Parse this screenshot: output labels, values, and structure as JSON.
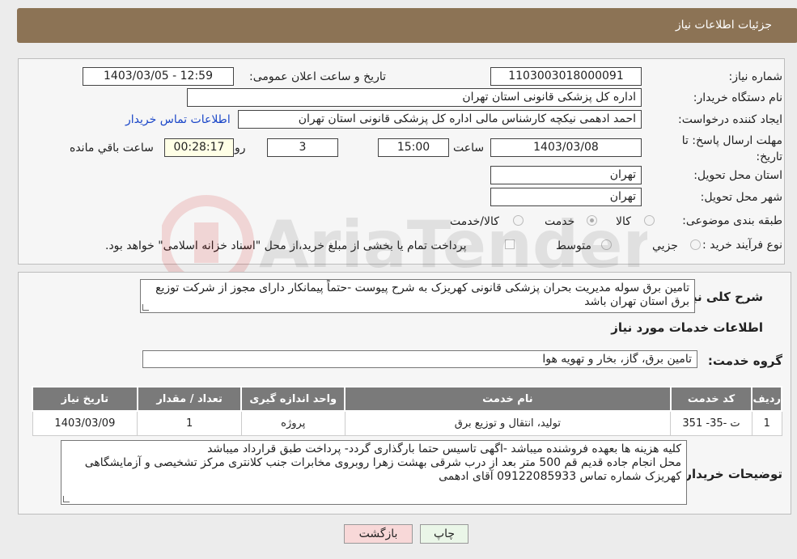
{
  "header": {
    "title": "جزئیات اطلاعات نیاز"
  },
  "form": {
    "need_number": {
      "label": "شماره نیاز:",
      "value": "1103003018000091"
    },
    "announce_datetime": {
      "label": "تاریخ و ساعت اعلان عمومی:",
      "value": "1403/03/05 - 12:59"
    },
    "buyer_org": {
      "label": "نام دستگاه خریدار:",
      "value": "اداره کل پزشکی قانونی استان تهران"
    },
    "requester": {
      "label": "ایجاد کننده درخواست:",
      "value": "احمد ادهمی نیکچه کارشناس مالی اداره کل پزشکی قانونی استان تهران",
      "contact_link": "اطلاعات تماس خریدار"
    },
    "deadline": {
      "label": "مهلت ارسال پاسخ: تا تاریخ:",
      "date": "1403/03/08",
      "time_label": "ساعت",
      "time": "15:00",
      "days": "3",
      "days_label": "روز و",
      "remaining": "00:28:17",
      "remaining_label": "ساعت باقي مانده"
    },
    "province": {
      "label": "استان محل تحویل:",
      "value": "تهران"
    },
    "city": {
      "label": "شهر محل تحویل:",
      "value": "تهران"
    },
    "category": {
      "label": "طبقه بندی موضوعی:",
      "options": [
        "کالا",
        "خدمت",
        "کالا/خدمت"
      ],
      "selected": "خدمت"
    },
    "purchase_type": {
      "label": "نوع فرآیند خرید :",
      "options": [
        "جزیي",
        "متوسط"
      ],
      "payment_note": "پرداخت تمام یا بخشی از مبلغ خرید،از محل \"اسناد خزانه اسلامی\" خواهد بود."
    }
  },
  "description": {
    "label": "شرح کلی نیاز:",
    "text": "تامین برق سوله مدیریت بحران پزشکی قانونی کهریزک به شرح پیوست -حتماً پیمانکار دارای مجوز از شرکت توزیع برق استان تهران باشد"
  },
  "services": {
    "section_title": "اطلاعات خدمات مورد نیاز",
    "group_label": "گروه خدمت:",
    "group_value": "تامین برق، گاز، بخار و تهویه هوا",
    "table": {
      "headers": [
        "ردیف",
        "کد خدمت",
        "نام خدمت",
        "واحد اندازه گیری",
        "تعداد / مقدار",
        "تاریخ نیاز"
      ],
      "rows": [
        [
          "1",
          "ت -35- 351",
          "تولید، انتقال و توزیع برق",
          "پروژه",
          "1",
          "1403/03/09"
        ]
      ]
    }
  },
  "buyer_notes": {
    "label": "توضیحات خریدار:",
    "lines": [
      "کلیه هزینه ها بعهده فروشنده میباشد -اگهی تاسیس حتما بارگذاری گردد- پرداخت طبق قرارداد میباشد",
      "محل انجام جاده قدیم قم 500 متر بعد از درب شرقی بهشت زهرا روبروی مخابرات جنب کلانتری مرکز تشخیصی و آزمایشگاهی کهریزک شماره تماس 09122085933 آقای ادهمی"
    ]
  },
  "buttons": {
    "print": "چاپ",
    "back": "بازگشت"
  },
  "colors": {
    "header": "#8c7355",
    "table_header": "#7a7a7a",
    "link": "#1a46c8",
    "back_button": "#f8d8d8"
  }
}
